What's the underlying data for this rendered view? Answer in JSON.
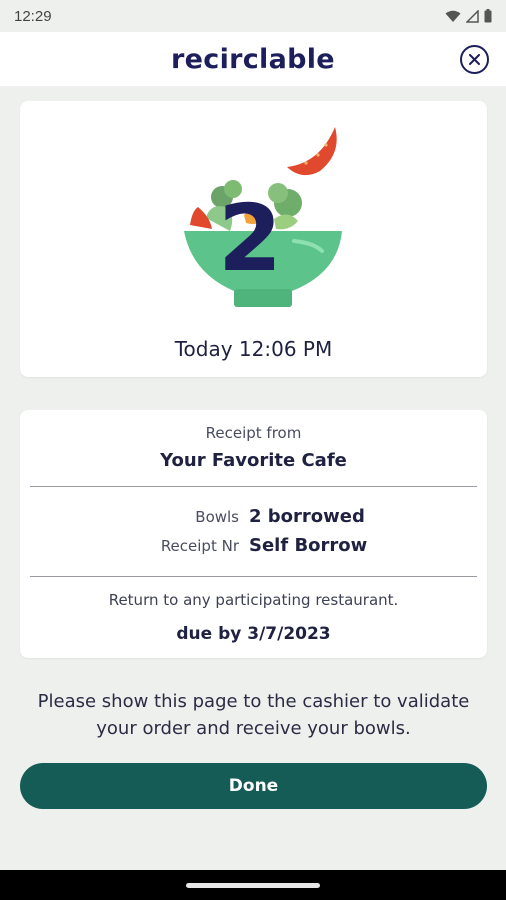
{
  "status_bar": {
    "time": "12:29",
    "icons": [
      "wifi-icon",
      "signal-icon",
      "battery-icon"
    ]
  },
  "header": {
    "brand": "recirclable",
    "close_icon": "close-icon"
  },
  "hero": {
    "bowl_count": "2",
    "time": "Today 12:06 PM"
  },
  "receipt": {
    "from_label": "Receipt from",
    "restaurant": "Your Favorite Cafe",
    "bowls_label": "Bowls",
    "bowls_value": "2 borrowed",
    "receipt_nr_label": "Receipt Nr",
    "receipt_nr_value": "Self Borrow",
    "return_note": "Return to any participating restaurant.",
    "due": "due by 3/7/2023"
  },
  "instructions": "Please show this page to the cashier to validate your order and receive your bowls.",
  "done_button": "Done",
  "colors": {
    "brand": "#1d1f5c",
    "primary_button": "#155c56",
    "bowl_green": "#5cc48a",
    "tomato": "#e0492e",
    "background": "#eef0ee"
  }
}
